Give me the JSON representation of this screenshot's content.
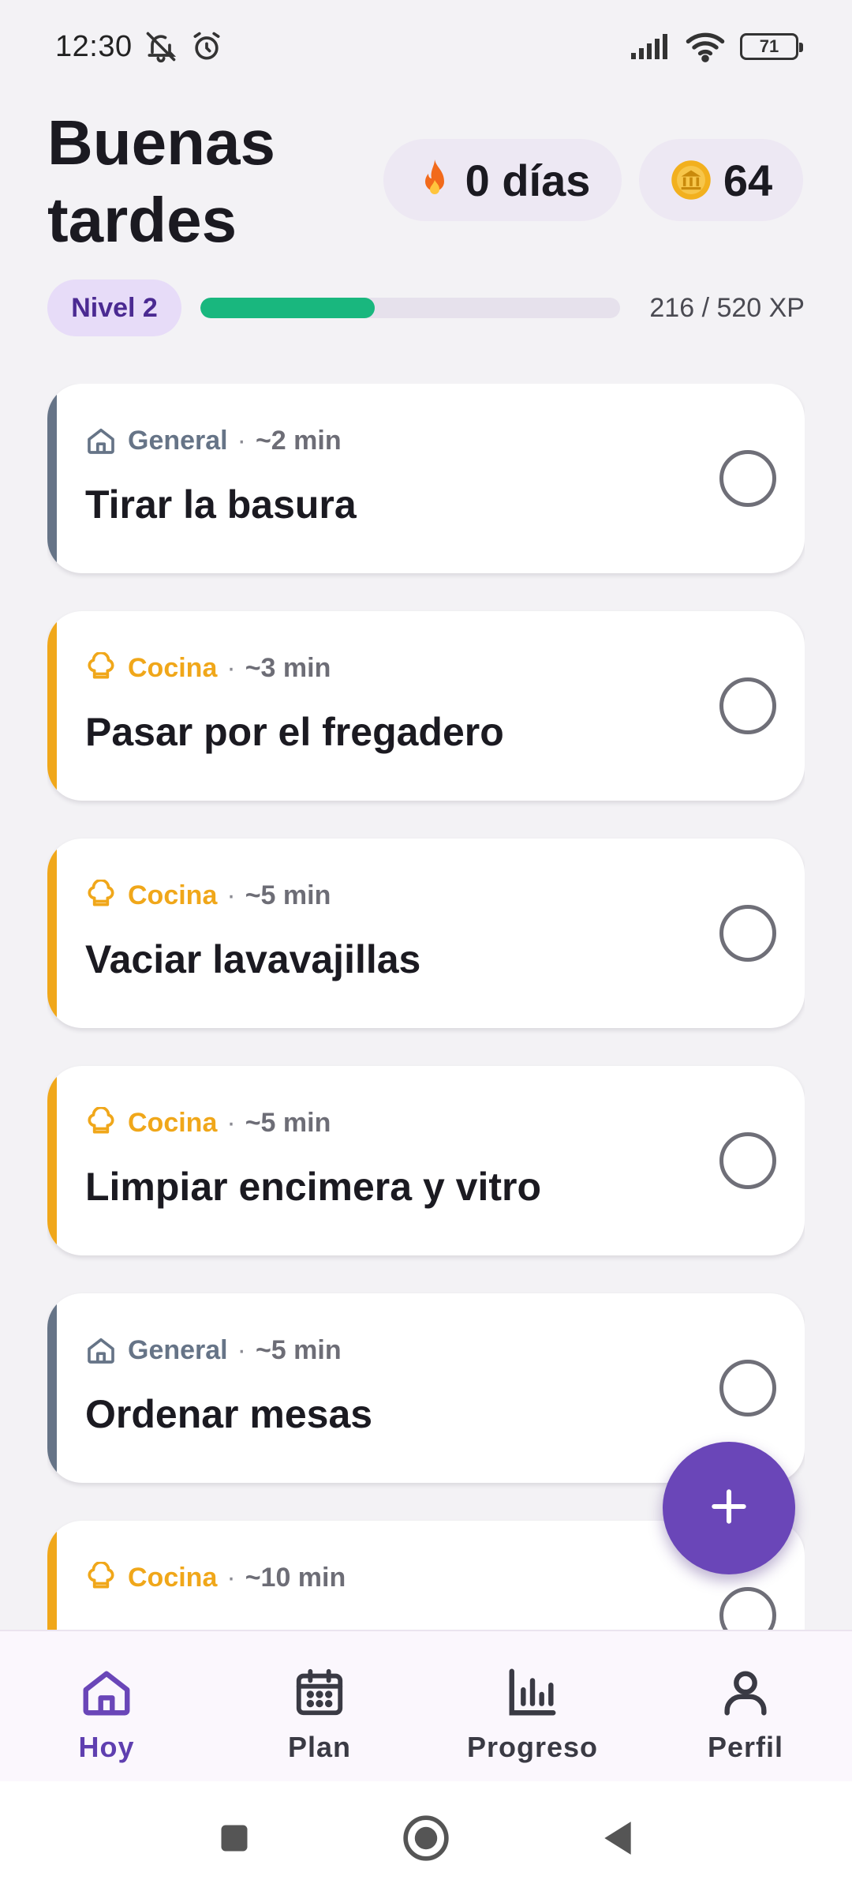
{
  "status_bar": {
    "time": "12:30",
    "battery": "71"
  },
  "header": {
    "greeting": "Buenas tardes",
    "streak": "0 días",
    "coins": "64"
  },
  "level": {
    "label": "Nivel 2",
    "xp_text": "216 / 520 XP",
    "xp_current": 216,
    "xp_max": 520
  },
  "colors": {
    "general": "#667487",
    "cocina": "#f0a71a",
    "primary": "#6a46b8",
    "xp": "#19b77e"
  },
  "tasks": [
    {
      "category": "General",
      "category_key": "general",
      "icon": "home-icon",
      "time": "~2 min",
      "title": "Tirar la basura"
    },
    {
      "category": "Cocina",
      "category_key": "cocina",
      "icon": "chef-hat-icon",
      "time": "~3 min",
      "title": "Pasar por el fregadero"
    },
    {
      "category": "Cocina",
      "category_key": "cocina",
      "icon": "chef-hat-icon",
      "time": "~5 min",
      "title": "Vaciar lavavajillas"
    },
    {
      "category": "Cocina",
      "category_key": "cocina",
      "icon": "chef-hat-icon",
      "time": "~5 min",
      "title": "Limpiar encimera y vitro"
    },
    {
      "category": "General",
      "category_key": "general",
      "icon": "home-icon",
      "time": "~5 min",
      "title": "Ordenar mesas"
    },
    {
      "category": "Cocina",
      "category_key": "cocina",
      "icon": "chef-hat-icon",
      "time": "~10 min",
      "title": ""
    }
  ],
  "nav": {
    "items": [
      {
        "label": "Hoy",
        "icon": "home-icon",
        "active": true
      },
      {
        "label": "Plan",
        "icon": "calendar-icon",
        "active": false
      },
      {
        "label": "Progreso",
        "icon": "bar-chart-icon",
        "active": false
      },
      {
        "label": "Perfil",
        "icon": "person-icon",
        "active": false
      }
    ]
  }
}
